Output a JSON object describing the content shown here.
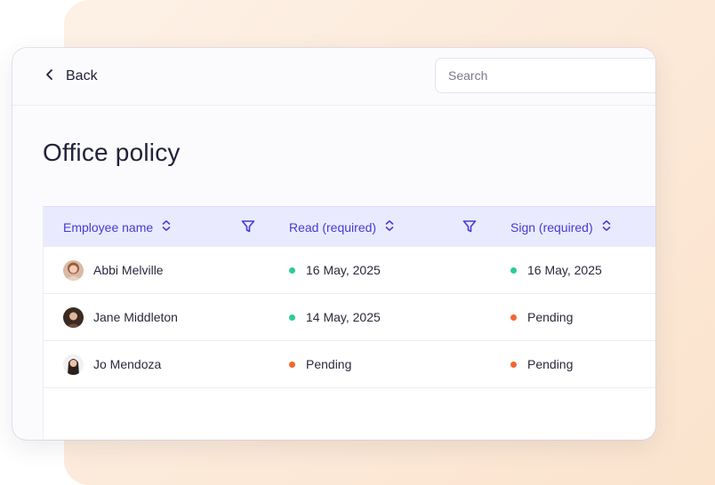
{
  "header": {
    "back_label": "Back",
    "search_placeholder": "Search"
  },
  "page": {
    "title": "Office policy"
  },
  "table": {
    "columns": [
      {
        "label": "Employee name"
      },
      {
        "label": "Read (required)"
      },
      {
        "label": "Sign (required)"
      }
    ],
    "rows": [
      {
        "name": "Abbi Melville",
        "read": "16 May, 2025",
        "read_status": "done",
        "sign": "16 May, 2025",
        "sign_status": "done"
      },
      {
        "name": "Jane Middleton",
        "read": "14 May, 2025",
        "read_status": "done",
        "sign": "Pending",
        "sign_status": "pending"
      },
      {
        "name": "Jo Mendoza",
        "read": "Pending",
        "read_status": "pending",
        "sign": "Pending",
        "sign_status": "pending"
      }
    ]
  },
  "colors": {
    "accent": "#4a3ad3",
    "done": "#2ecb94",
    "pending": "#f1672e"
  },
  "icons": {
    "back": "chevron-left-icon",
    "sort": "sort-icon",
    "filter": "filter-icon"
  }
}
